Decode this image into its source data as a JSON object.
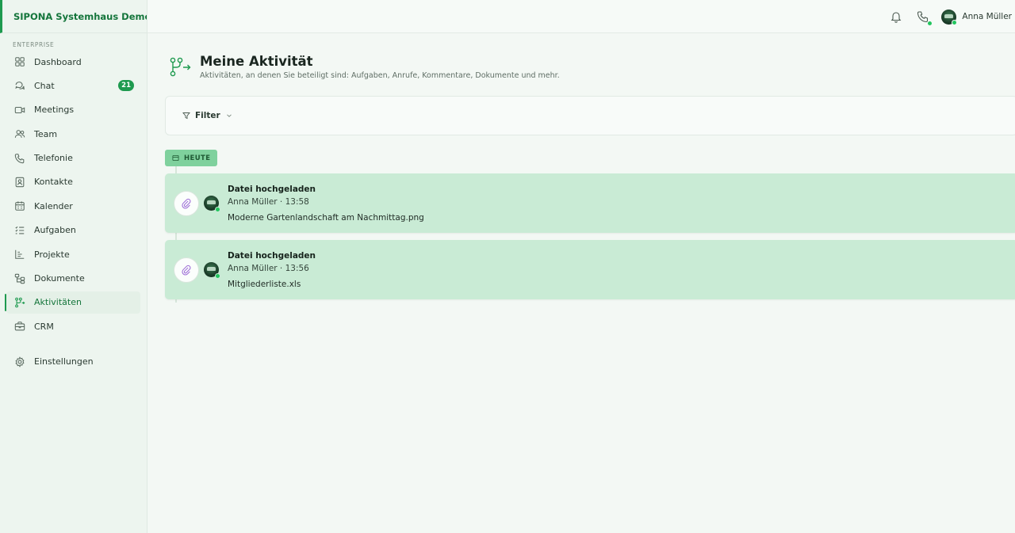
{
  "app": {
    "workspace_name": "SIPONA Systemhaus Demo...",
    "section_label": "ENTERPRISE"
  },
  "sidebar": {
    "items": [
      {
        "label": "Dashboard",
        "icon": "grid-icon"
      },
      {
        "label": "Chat",
        "icon": "chat-icon",
        "badge": "21"
      },
      {
        "label": "Meetings",
        "icon": "video-icon"
      },
      {
        "label": "Team",
        "icon": "users-icon"
      },
      {
        "label": "Telefonie",
        "icon": "phone-icon"
      },
      {
        "label": "Kontakte",
        "icon": "contact-card-icon"
      },
      {
        "label": "Kalender",
        "icon": "calendar-icon"
      },
      {
        "label": "Aufgaben",
        "icon": "task-list-icon"
      },
      {
        "label": "Projekte",
        "icon": "chart-icon"
      },
      {
        "label": "Dokumente",
        "icon": "folder-tree-icon"
      },
      {
        "label": "Aktivitäten",
        "icon": "activity-icon",
        "active": true
      },
      {
        "label": "CRM",
        "icon": "briefcase-icon"
      },
      {
        "label": "Einstellungen",
        "icon": "gear-icon"
      }
    ]
  },
  "topbar": {
    "user_name": "Anna Müller",
    "icons": [
      "bell-icon",
      "phone-icon",
      "avatar"
    ]
  },
  "page": {
    "title": "Meine Aktivität",
    "subtitle": "Aktivitäten, an denen Sie beteiligt sind: Aufgaben, Anrufe, Kommentare, Dokumente und mehr."
  },
  "filter": {
    "label": "Filter"
  },
  "timeline": {
    "day_label": "HEUTE",
    "activities": [
      {
        "title": "Datei hochgeladen",
        "meta": "Anna Müller · 13:58",
        "file": "Moderne Gartenlandschaft am Nachmittag.png"
      },
      {
        "title": "Datei hochgeladen",
        "meta": "Anna Müller · 13:56",
        "file": "Mitgliederliste.xls"
      }
    ]
  },
  "colors": {
    "accent": "#1e9a4f",
    "brand_text": "#14753b",
    "card_bg": "#c9ebd5",
    "pill_bg": "#7fd19d",
    "online": "#22c55e"
  }
}
